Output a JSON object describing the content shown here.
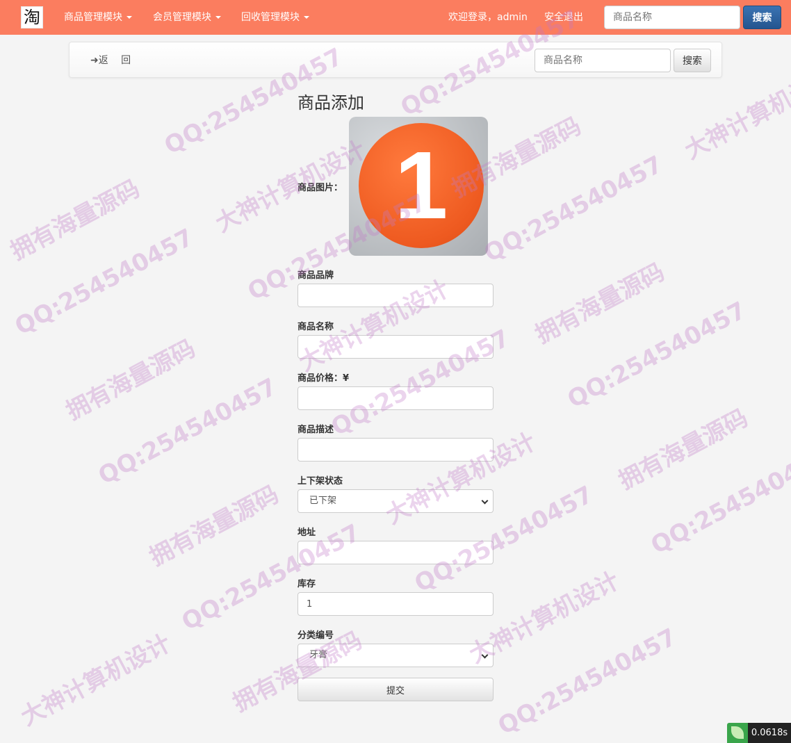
{
  "navbar": {
    "logo_text": "淘",
    "menus": [
      {
        "label": "商品管理模块"
      },
      {
        "label": "会员管理模块"
      },
      {
        "label": "回收管理模块"
      }
    ],
    "welcome": "欢迎登录，admin",
    "logout": "安全退出",
    "search_placeholder": "商品名称",
    "search_button": "搜索"
  },
  "toolbar": {
    "back_label": "➜返 回",
    "search_placeholder": "商品名称",
    "search_button": "搜索"
  },
  "form": {
    "title": "商品添加",
    "image_label": "商品图片：",
    "image_number": "1",
    "brand_label": "商品品牌",
    "brand_value": "",
    "name_label": "商品名称",
    "name_value": "",
    "price_label": "商品价格：¥",
    "price_value": "",
    "desc_label": "商品描述",
    "desc_value": "",
    "status_label": "上下架状态",
    "status_value": "已下架",
    "address_label": "地址",
    "address_value": "",
    "stock_label": "库存",
    "stock_value": "1",
    "category_label": "分类编号",
    "category_value": "牙膏",
    "submit_label": "提交"
  },
  "timer": {
    "value": "0.0618s"
  },
  "watermark": {
    "qq": "QQ:254540457",
    "line1": "大神计算机设计",
    "line2": "拥有海量源码"
  },
  "colors": {
    "navbar": "#fb7d5f",
    "search_button": "#2f64a0",
    "watermark": "#c078c8",
    "badge_icon": "#3aa54b"
  }
}
